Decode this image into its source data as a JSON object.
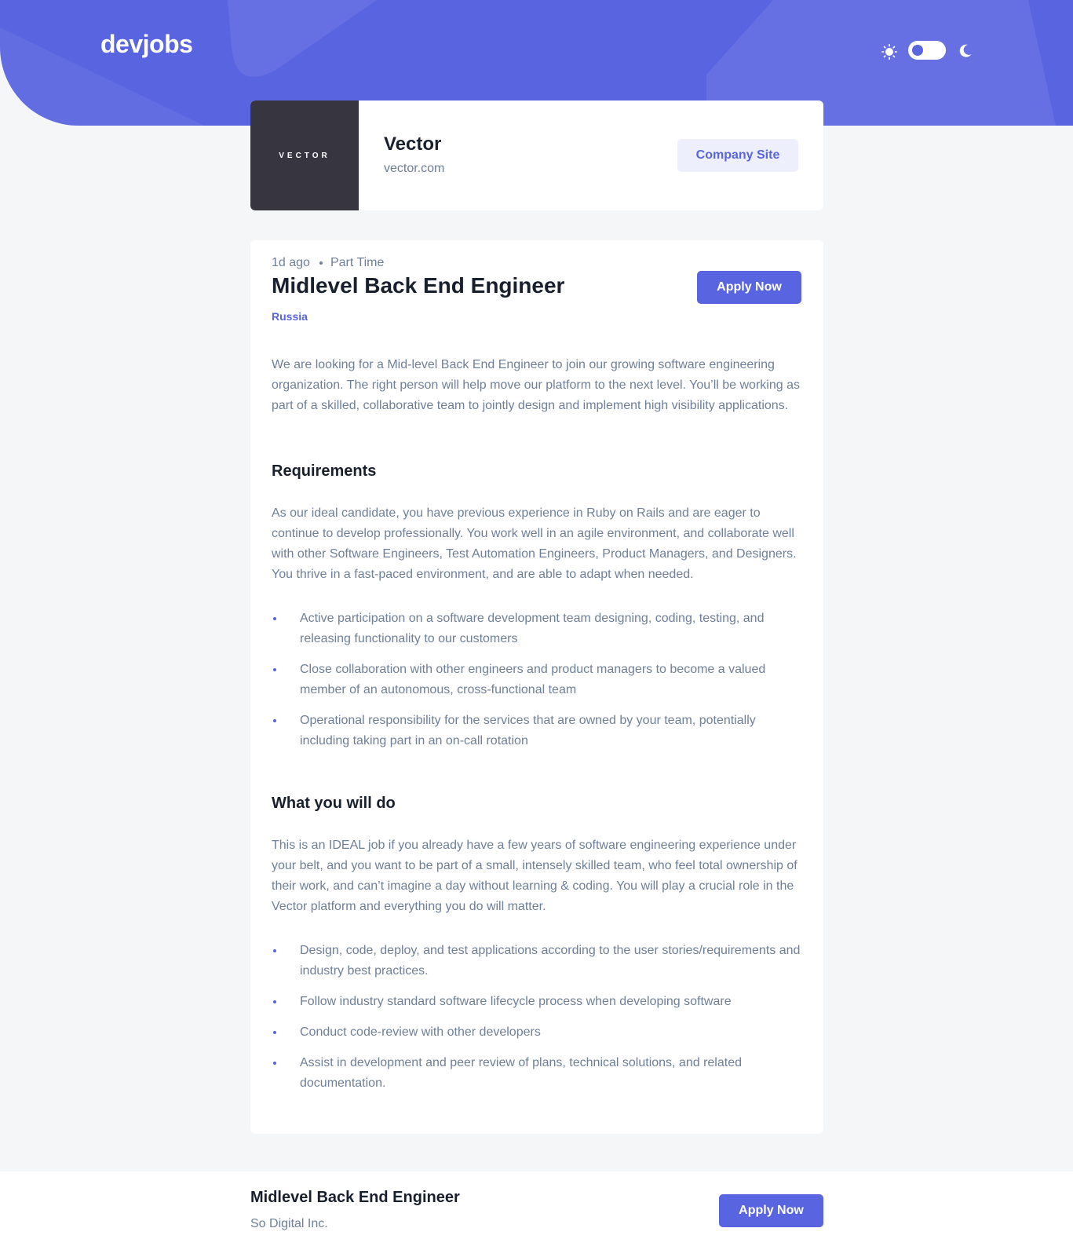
{
  "header": {
    "logo": "devjobs",
    "theme_toggle": {
      "light_icon": "sun-icon",
      "dark_icon": "moon-icon",
      "mode": "light"
    }
  },
  "company": {
    "logo_text": "VECTOR",
    "name": "Vector",
    "domain": "vector.com",
    "site_button": "Company Site"
  },
  "job": {
    "posted": "1d ago",
    "contract": "Part Time",
    "title": "Midlevel Back End Engineer",
    "location": "Russia",
    "apply_label": "Apply Now",
    "description": "We are looking for a Mid-level Back End Engineer to join our growing software engineering organization. The right person will help move our platform to the next level. You’ll be working as part of a skilled, collaborative team to jointly design and implement high visibility applications.",
    "requirements": {
      "heading": "Requirements",
      "content": "As our ideal candidate, you have previous experience in Ruby on Rails and are eager to continue to develop professionally. You work well in an agile environment, and collaborate well with other Software Engineers, Test Automation Engineers, Product Managers, and Designers. You thrive in a fast-paced environment, and are able to adapt when needed.",
      "items": [
        "Active participation on a software development team designing, coding, testing, and releasing functionality to our customers",
        "Close collaboration with other engineers and product managers to become a valued member of an autonomous, cross-functional team",
        "Operational responsibility for the services that are owned by your team, potentially including taking part in an on-call rotation"
      ]
    },
    "role": {
      "heading": "What you will do",
      "content": "This is an IDEAL job if you already have a few years of software engineering experience under your belt, and you want to be part of a small, intensely skilled team, who feel total ownership of their work, and can’t imagine a day without learning & coding. You will play a crucial role in the Vector platform and everything you do will matter.",
      "items": [
        "Design, code, deploy, and test applications according to the user stories/requirements and industry best practices.",
        "Follow industry standard software lifecycle process when developing software",
        "Conduct code-review with other developers",
        "Assist in development and peer review of plans, technical solutions, and related documentation."
      ]
    }
  },
  "footer": {
    "title": "Midlevel Back End Engineer",
    "company": "So Digital Inc.",
    "apply_label": "Apply Now"
  },
  "colors": {
    "accent": "#5964e0",
    "dark_text": "#19202d",
    "gray_text": "#6e8098",
    "page_bg": "#f4f6f8",
    "logo_bg": "#363540"
  }
}
